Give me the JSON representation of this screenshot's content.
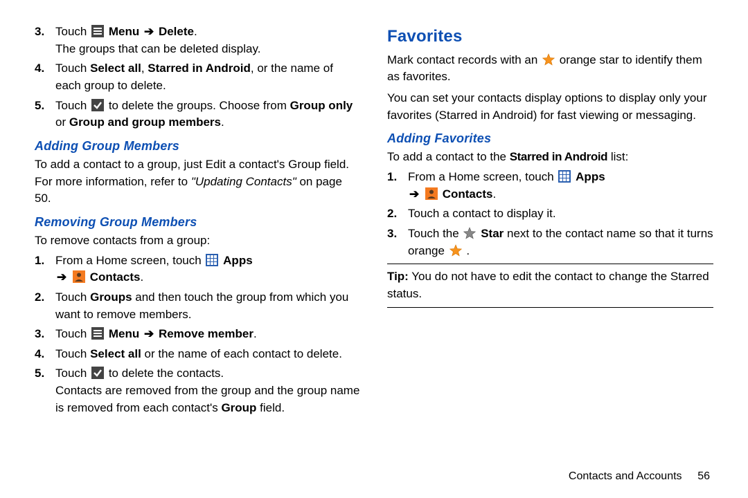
{
  "left": {
    "steps_top": [
      {
        "num": "3.",
        "pre": "Touch ",
        "icon": "menu",
        "mid_bold": "Menu",
        "arrow": "➔",
        "post_bold": "Delete",
        "tail": ".",
        "line2": "The groups that can be deleted display."
      },
      {
        "num": "4.",
        "pre": "Touch ",
        "bold1": "Select all",
        "mid1": ", ",
        "bold2": "Starred in Android",
        "mid2": ", or the name of each group to delete."
      },
      {
        "num": "5.",
        "pre": "Touch ",
        "icon": "check",
        "mid": " to delete the groups. Choose from ",
        "bold1": "Group only",
        "mid2": " or ",
        "bold2": "Group and group members",
        "tail": "."
      }
    ],
    "h_add": "Adding Group Members",
    "add_para_pre": "To add a contact to a group, just Edit a contact's Group field. For more information, refer to ",
    "add_para_ref": "\"Updating Contacts\"",
    "add_para_post": " on page 50.",
    "h_remove": "Removing Group Members",
    "remove_intro": "To remove contacts from a group:",
    "steps_remove": [
      {
        "num": "1.",
        "pre": "From a Home screen, touch ",
        "icon": "apps",
        "bold1": "Apps",
        "arrow": "➔",
        "icon2": "contacts",
        "bold2": "Contacts",
        "tail": "."
      },
      {
        "num": "2.",
        "pre": "Touch ",
        "bold1": "Groups",
        "mid": " and then touch the group from which you want to remove members."
      },
      {
        "num": "3.",
        "pre": "Touch ",
        "icon": "menu",
        "bold1": "Menu",
        "arrow": "➔",
        "bold2": "Remove member",
        "tail": "."
      },
      {
        "num": "4.",
        "pre": "Touch ",
        "bold1": "Select all",
        "mid": " or the name of each contact to delete."
      },
      {
        "num": "5.",
        "pre": "Touch ",
        "icon": "check",
        "mid": " to delete the contacts.",
        "line2": "Contacts are removed from the group and the group name is removed from each contact's ",
        "bold1": "Group",
        "tail": " field."
      }
    ]
  },
  "right": {
    "h_fav": "Favorites",
    "fav_p1_pre": "Mark contact records with an ",
    "fav_p1_mid": " orange star to identify them as favorites.",
    "fav_p2": "You can set your contacts display options to display only your favorites (Starred in Android) for fast viewing or messaging.",
    "h_addfav": "Adding Favorites",
    "addfav_intro_pre": "To add a contact to the ",
    "addfav_intro_bold": "Starred in Android",
    "addfav_intro_post": " list:",
    "steps_addfav": [
      {
        "num": "1.",
        "pre": "From a Home screen, touch ",
        "icon": "apps",
        "bold1": "Apps",
        "arrow": "➔",
        "icon2": "contacts",
        "bold2": "Contacts",
        "tail": "."
      },
      {
        "num": "2.",
        "text": "Touch a contact to display it."
      },
      {
        "num": "3.",
        "pre": "Touch the ",
        "icon": "star-grey",
        "bold1": "Star",
        "mid": " next to the contact name so that it turns orange ",
        "icon2": "star-orange",
        "tail": "."
      }
    ],
    "tip_label": "Tip:",
    "tip_body": " You do not have to edit the contact to change the Starred status."
  },
  "footer": {
    "label": "Contacts and Accounts",
    "page": "56"
  }
}
